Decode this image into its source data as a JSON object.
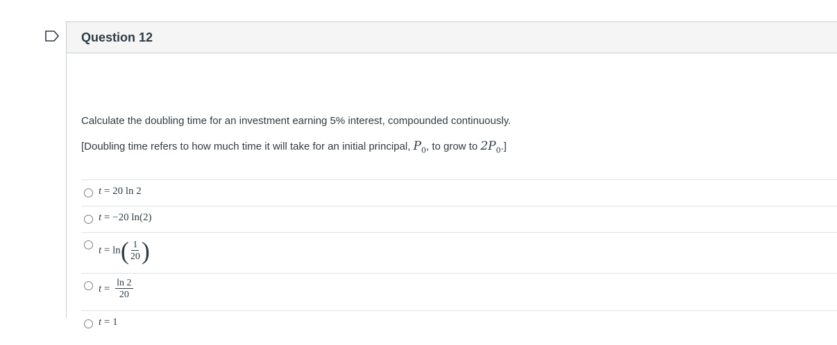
{
  "question": {
    "title": "Question 12",
    "stem": "Calculate the doubling time for an investment earning 5% interest, compounded continuously.",
    "note_prefix": "[Doubling time refers to how much time it will take for an initial principal, ",
    "note_p0": "P",
    "note_sub0": "0",
    "note_mid": ", to grow to ",
    "note_2p0": "2P",
    "note_sub1": "0",
    "note_suffix": ".]"
  },
  "answers": [
    {
      "var": "t",
      "eq": " = ",
      "expr": "20 ln 2"
    },
    {
      "var": "t",
      "eq": " = ",
      "expr": "−20 ln(2)"
    },
    {
      "var": "t",
      "eq": " = ",
      "fn": "ln",
      "num": "1",
      "den": "20"
    },
    {
      "var": "t",
      "eq": " = ",
      "num": "ln 2",
      "den": "20"
    },
    {
      "var": "t",
      "eq": " = ",
      "expr": "1"
    }
  ]
}
